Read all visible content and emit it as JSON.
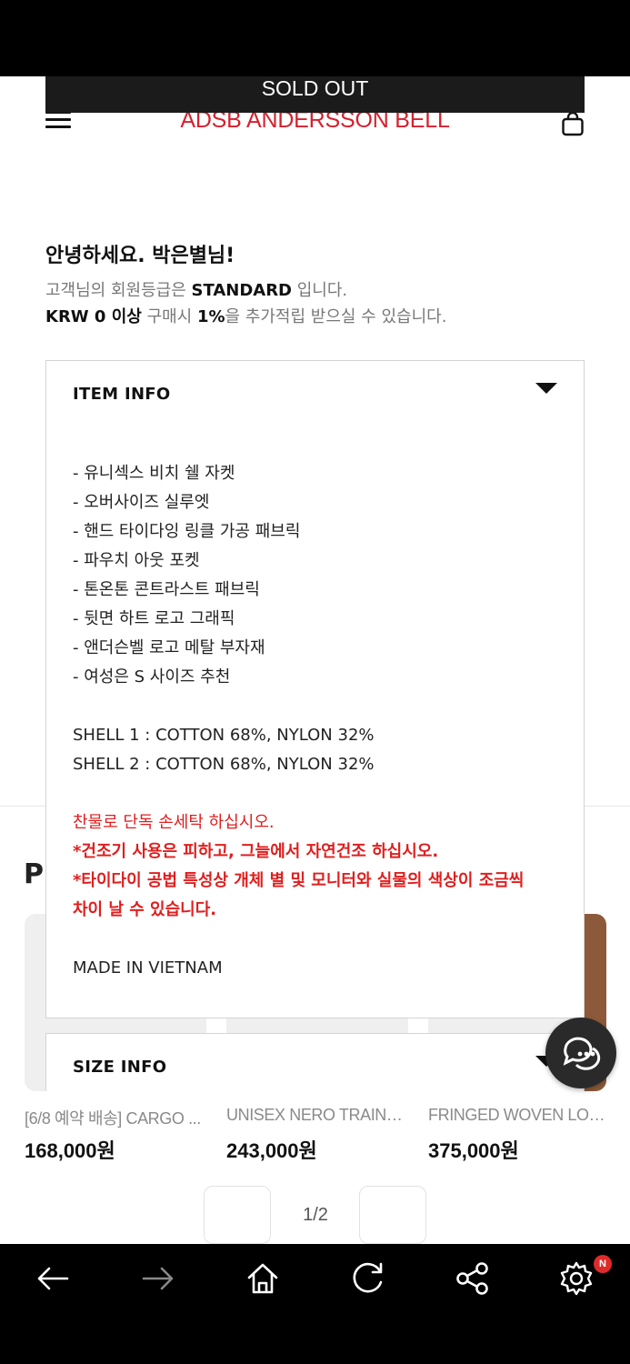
{
  "header": {
    "logo_text": "ADSB  ANDERSSON BELL",
    "sold_out_label": "SOLD OUT"
  },
  "greeting": {
    "title": "안녕하세요. 박은별님!",
    "line1_prefix": "고객님의 회원등급은 ",
    "line1_grade": "STANDARD",
    "line1_suffix": " 입니다.",
    "line2_amount": "KRW 0 이상",
    "line2_mid": " 구매시 ",
    "line2_rate": "1%",
    "line2_suffix": "을 추가적립 받으실 수 있습니다."
  },
  "item_info": {
    "title": "ITEM INFO",
    "features": [
      "- 유니섹스 비치 쉘 자켓",
      "- 오버사이즈 실루엣",
      "- 핸드 타이다잉 링클 가공 패브릭",
      "- 파우치 아웃 포켓",
      "- 톤온톤 콘트라스트 패브릭",
      "- 뒷면 하트 로고 그래픽",
      "- 앤더슨벨 로고 메탈 부자재",
      "- 여성은 S 사이즈 추천"
    ],
    "composition": [
      "SHELL 1 : COTTON 68%, NYLON 32%",
      "SHELL 2 : COTTON 68%, NYLON 32%"
    ],
    "care_notes": [
      "찬물로 단독 손세탁 하십시오.",
      "*건조기 사용은 피하고, 그늘에서 자연건조 하십시오.",
      "*타이다이 공법 특성상 개체 별 및 모니터와 실물의 색상이 조금씩",
      "차이 날 수 있습니다."
    ],
    "origin": "MADE IN VIETNAM"
  },
  "size_info": {
    "title": "SIZE INFO"
  },
  "products": {
    "section_initial": "P",
    "items": [
      {
        "name": "[6/8 예약 배송] CARGO ...",
        "price": "168,000원"
      },
      {
        "name": "UNISEX NERO TRAINE...",
        "price": "243,000원"
      },
      {
        "name": "FRINGED WOVEN LOA...",
        "price": "375,000원"
      }
    ],
    "pager": "1/2"
  },
  "nav": {
    "badge": "N"
  },
  "colors": {
    "brand_red": "#d6202e",
    "care_red": "#e01e1e"
  }
}
